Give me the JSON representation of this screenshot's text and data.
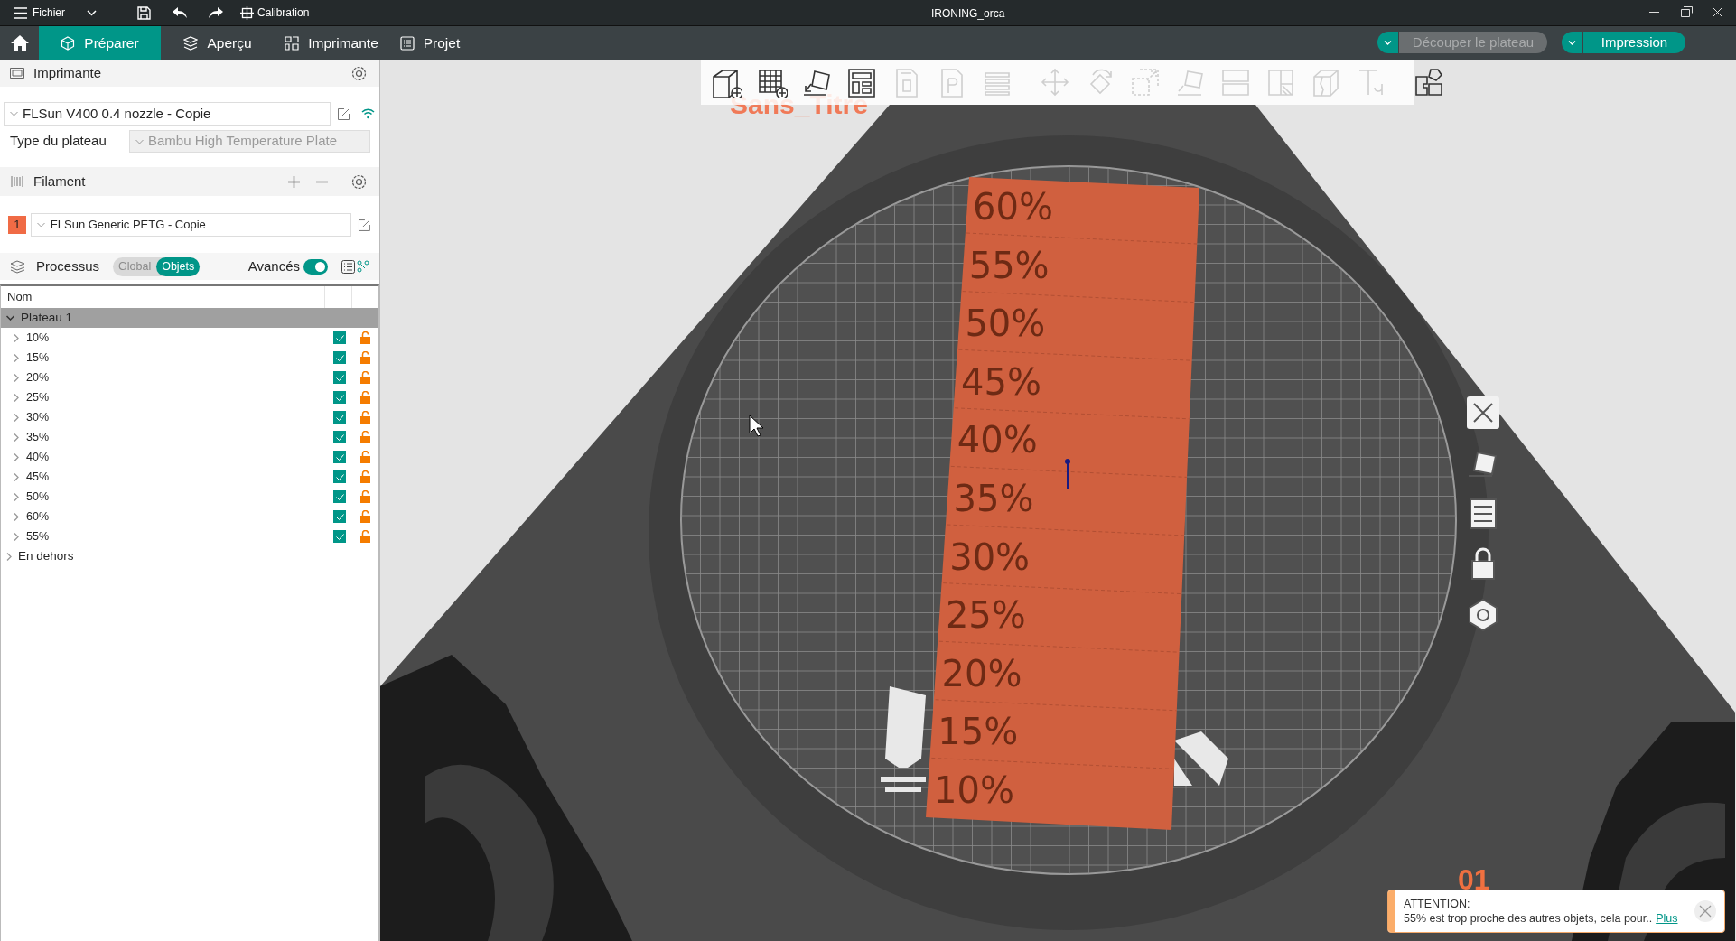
{
  "window": {
    "title": "IRONING_orca"
  },
  "menu": {
    "file": "Fichier",
    "calibration": "Calibration"
  },
  "tabs": [
    {
      "label": "Préparer",
      "selected": true
    },
    {
      "label": "Aperçu",
      "selected": false
    },
    {
      "label": "Imprimante",
      "selected": false
    },
    {
      "label": "Projet",
      "selected": false
    }
  ],
  "actions": [
    {
      "label": "Découper le plateau",
      "disabled": true
    },
    {
      "label": "Impression",
      "disabled": false
    }
  ],
  "printer": {
    "title": "Imprimante",
    "preset": "FLSun V400 0.4 nozzle - Copie",
    "plate_type_label": "Type du plateau",
    "plate_type": {
      "value": "Bambu High Temperature Plate",
      "disabled": true
    }
  },
  "filament": {
    "title": "Filament",
    "slots": [
      {
        "number": "1",
        "color": "#f06b45",
        "preset": "FLSun Generic PETG - Copie"
      }
    ]
  },
  "process": {
    "title": "Processus",
    "scopes": [
      {
        "label": "Global",
        "selected": false
      },
      {
        "label": "Objets",
        "selected": true
      }
    ],
    "advanced_label": "Avancés",
    "advanced_on": true
  },
  "objects": {
    "column": "Nom",
    "tree": [
      {
        "label": "Plateau 1",
        "expanded": true,
        "children": [
          {
            "label": "10%",
            "expanded": false,
            "printable": true,
            "locked": false
          },
          {
            "label": "15%",
            "expanded": false,
            "printable": true,
            "locked": false
          },
          {
            "label": "20%",
            "expanded": false,
            "printable": true,
            "locked": false
          },
          {
            "label": "25%",
            "expanded": false,
            "printable": true,
            "locked": false
          },
          {
            "label": "30%",
            "expanded": false,
            "printable": true,
            "locked": false
          },
          {
            "label": "35%",
            "expanded": false,
            "printable": true,
            "locked": false
          },
          {
            "label": "40%",
            "expanded": false,
            "printable": true,
            "locked": false
          },
          {
            "label": "45%",
            "expanded": false,
            "printable": true,
            "locked": false
          },
          {
            "label": "50%",
            "expanded": false,
            "printable": true,
            "locked": false
          },
          {
            "label": "60%",
            "expanded": false,
            "printable": true,
            "locked": false
          },
          {
            "label": "55%",
            "expanded": false,
            "printable": true,
            "locked": false
          }
        ]
      },
      {
        "label": "En dehors",
        "expanded": false
      }
    ]
  },
  "viewport": {
    "toolbar_groups": [
      [
        {
          "disabled": false
        },
        {
          "disabled": false
        },
        {
          "disabled": false
        },
        {
          "disabled": false
        },
        {
          "disabled": true
        },
        {
          "disabled": true
        },
        {
          "disabled": true
        }
      ],
      [
        {
          "disabled": true
        },
        {
          "disabled": true
        },
        {
          "disabled": true
        },
        {
          "disabled": true
        },
        {
          "disabled": true
        },
        {
          "disabled": true
        },
        {
          "disabled": true
        },
        {
          "disabled": true
        }
      ],
      [
        {
          "disabled": false
        }
      ]
    ],
    "object_name": "Sans_Titre",
    "object_labels": [
      "60%",
      "55%",
      "50%",
      "45%",
      "40%",
      "35%",
      "30%",
      "25%",
      "20%",
      "15%",
      "10%"
    ],
    "plate_number": "01"
  },
  "notification": {
    "title": "ATTENTION:",
    "message": "55% est trop proche des autres objets, cela pour..",
    "link": "Plus"
  }
}
